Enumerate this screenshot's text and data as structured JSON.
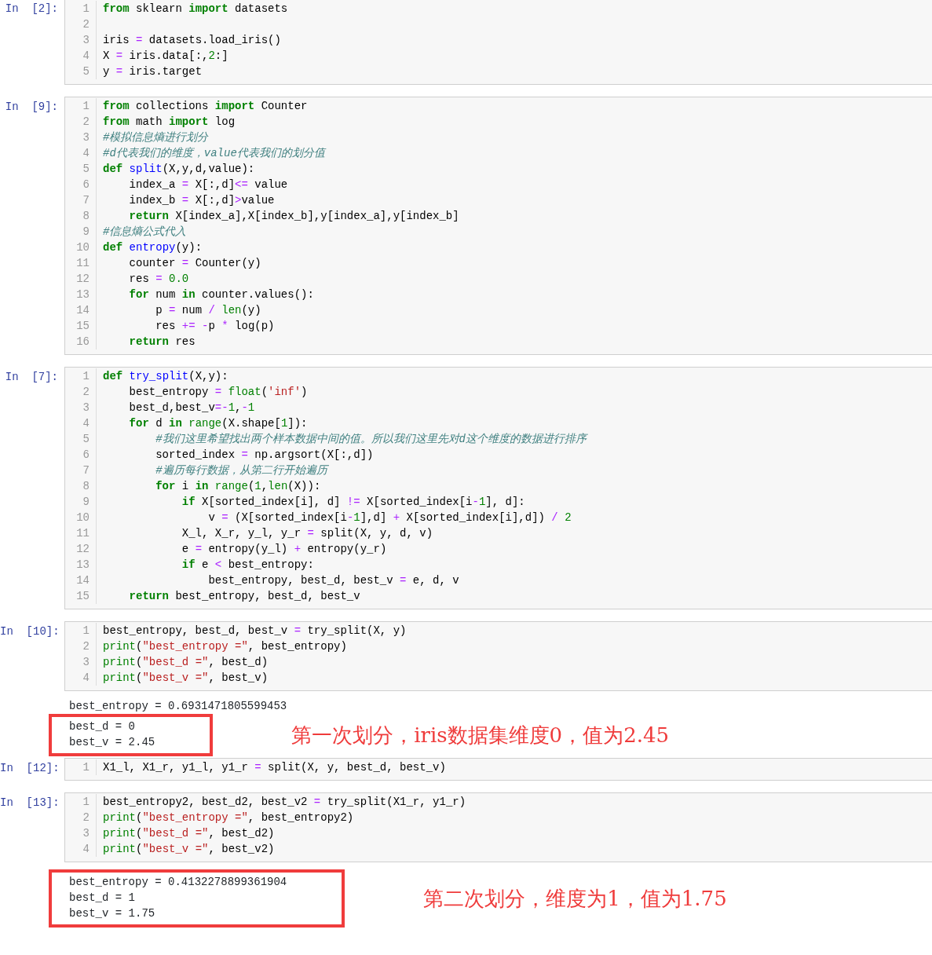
{
  "cells": [
    {
      "prompt": "In  [2]:",
      "lines": [
        {
          "num": "1",
          "tokens": [
            {
              "kind": "kw",
              "text": "from"
            },
            {
              "kind": "tx",
              "text": " sklearn "
            },
            {
              "kind": "kw",
              "text": "import"
            },
            {
              "kind": "tx",
              "text": " datasets"
            }
          ]
        },
        {
          "num": "2"
        },
        {
          "num": "3",
          "tokens": [
            {
              "kind": "tx",
              "text": "iris "
            },
            {
              "kind": "op",
              "text": "="
            },
            {
              "kind": "tx",
              "text": " datasets.load_iris()"
            }
          ]
        },
        {
          "num": "4",
          "tokens": [
            {
              "kind": "tx",
              "text": "X "
            },
            {
              "kind": "op",
              "text": "="
            },
            {
              "kind": "tx",
              "text": " iris.data[:,"
            },
            {
              "kind": "num",
              "text": "2"
            },
            {
              "kind": "tx",
              "text": ":]"
            }
          ]
        },
        {
          "num": "5",
          "tokens": [
            {
              "kind": "tx",
              "text": "y "
            },
            {
              "kind": "op",
              "text": "="
            },
            {
              "kind": "tx",
              "text": " iris.target"
            }
          ]
        }
      ]
    },
    {
      "prompt": "In  [9]:",
      "lines": [
        {
          "num": "1",
          "tokens": [
            {
              "kind": "kw",
              "text": "from"
            },
            {
              "kind": "tx",
              "text": " collections "
            },
            {
              "kind": "kw",
              "text": "import"
            },
            {
              "kind": "tx",
              "text": " Counter"
            }
          ]
        },
        {
          "num": "2",
          "tokens": [
            {
              "kind": "kw",
              "text": "from"
            },
            {
              "kind": "tx",
              "text": " math "
            },
            {
              "kind": "kw",
              "text": "import"
            },
            {
              "kind": "tx",
              "text": " log"
            }
          ]
        },
        {
          "num": "3",
          "tokens": [
            {
              "kind": "cm",
              "text": "#模拟信息熵进行划分"
            }
          ]
        },
        {
          "num": "4",
          "tokens": [
            {
              "kind": "cm",
              "text": "#d代表我们的维度，value代表我们的划分值"
            }
          ]
        },
        {
          "num": "5",
          "tokens": [
            {
              "kind": "kw",
              "text": "def"
            },
            {
              "kind": "fn",
              "text": " split"
            },
            {
              "kind": "tx",
              "text": "(X,y,d,value):"
            }
          ]
        },
        {
          "num": "6",
          "tokens": [
            {
              "kind": "tx",
              "text": "    index_a "
            },
            {
              "kind": "op",
              "text": "="
            },
            {
              "kind": "tx",
              "text": " X[:,d]"
            },
            {
              "kind": "op",
              "text": "<="
            },
            {
              "kind": "tx",
              "text": " value"
            }
          ]
        },
        {
          "num": "7",
          "tokens": [
            {
              "kind": "tx",
              "text": "    index_b "
            },
            {
              "kind": "op",
              "text": "="
            },
            {
              "kind": "tx",
              "text": " X[:,d]"
            },
            {
              "kind": "op",
              "text": ">"
            },
            {
              "kind": "tx",
              "text": "value"
            }
          ]
        },
        {
          "num": "8",
          "tokens": [
            {
              "kind": "kw",
              "text": "    return"
            },
            {
              "kind": "tx",
              "text": " X[index_a],X[index_b],y[index_a],y[index_b]"
            }
          ]
        },
        {
          "num": "9",
          "tokens": [
            {
              "kind": "cm",
              "text": "#信息熵公式代入"
            }
          ]
        },
        {
          "num": "10",
          "tokens": [
            {
              "kind": "kw",
              "text": "def"
            },
            {
              "kind": "fn",
              "text": " entropy"
            },
            {
              "kind": "tx",
              "text": "(y):"
            }
          ]
        },
        {
          "num": "11",
          "tokens": [
            {
              "kind": "tx",
              "text": "    counter "
            },
            {
              "kind": "op",
              "text": "="
            },
            {
              "kind": "tx",
              "text": " Counter(y)"
            }
          ]
        },
        {
          "num": "12",
          "tokens": [
            {
              "kind": "tx",
              "text": "    res "
            },
            {
              "kind": "op",
              "text": "="
            },
            {
              "kind": "num",
              "text": " 0.0"
            }
          ]
        },
        {
          "num": "13",
          "tokens": [
            {
              "kind": "kw",
              "text": "    for"
            },
            {
              "kind": "tx",
              "text": " num "
            },
            {
              "kind": "kw",
              "text": "in"
            },
            {
              "kind": "tx",
              "text": " counter.values():"
            }
          ]
        },
        {
          "num": "14",
          "tokens": [
            {
              "kind": "tx",
              "text": "        p "
            },
            {
              "kind": "op",
              "text": "="
            },
            {
              "kind": "tx",
              "text": " num "
            },
            {
              "kind": "op",
              "text": "/"
            },
            {
              "kind": "bi",
              "text": " len"
            },
            {
              "kind": "tx",
              "text": "(y)"
            }
          ]
        },
        {
          "num": "15",
          "tokens": [
            {
              "kind": "tx",
              "text": "        res "
            },
            {
              "kind": "op",
              "text": "+="
            },
            {
              "kind": "op",
              "text": " -"
            },
            {
              "kind": "tx",
              "text": "p "
            },
            {
              "kind": "op",
              "text": "*"
            },
            {
              "kind": "tx",
              "text": " log(p)"
            }
          ]
        },
        {
          "num": "16",
          "tokens": [
            {
              "kind": "kw",
              "text": "    return"
            },
            {
              "kind": "tx",
              "text": " res"
            }
          ]
        }
      ]
    },
    {
      "prompt": "In  [7]:",
      "lines": [
        {
          "num": "1",
          "tokens": [
            {
              "kind": "kw",
              "text": "def"
            },
            {
              "kind": "fn",
              "text": " try_split"
            },
            {
              "kind": "tx",
              "text": "(X,y):"
            }
          ]
        },
        {
          "num": "2",
          "tokens": [
            {
              "kind": "tx",
              "text": "    best_entropy "
            },
            {
              "kind": "op",
              "text": "="
            },
            {
              "kind": "bi",
              "text": " float"
            },
            {
              "kind": "tx",
              "text": "("
            },
            {
              "kind": "str",
              "text": "'inf'"
            },
            {
              "kind": "tx",
              "text": ")"
            }
          ]
        },
        {
          "num": "3",
          "tokens": [
            {
              "kind": "tx",
              "text": "    best_d,best_v"
            },
            {
              "kind": "op",
              "text": "=-"
            },
            {
              "kind": "num",
              "text": "1"
            },
            {
              "kind": "tx",
              "text": ","
            },
            {
              "kind": "op",
              "text": "-"
            },
            {
              "kind": "num",
              "text": "1"
            }
          ]
        },
        {
          "num": "4",
          "tokens": [
            {
              "kind": "kw",
              "text": "    for"
            },
            {
              "kind": "tx",
              "text": " d "
            },
            {
              "kind": "kw",
              "text": "in"
            },
            {
              "kind": "bi",
              "text": " range"
            },
            {
              "kind": "tx",
              "text": "(X.shape["
            },
            {
              "kind": "num",
              "text": "1"
            },
            {
              "kind": "tx",
              "text": "]):"
            }
          ]
        },
        {
          "num": "5",
          "tokens": [
            {
              "kind": "cm",
              "text": "        #我们这里希望找出两个样本数据中间的值。所以我们这里先对d这个维度的数据进行排序"
            }
          ]
        },
        {
          "num": "6",
          "tokens": [
            {
              "kind": "tx",
              "text": "        sorted_index "
            },
            {
              "kind": "op",
              "text": "="
            },
            {
              "kind": "tx",
              "text": " np.argsort(X[:,d])"
            }
          ]
        },
        {
          "num": "7",
          "tokens": [
            {
              "kind": "cm",
              "text": "        #遍历每行数据，从第二行开始遍历"
            }
          ]
        },
        {
          "num": "8",
          "tokens": [
            {
              "kind": "kw",
              "text": "        for"
            },
            {
              "kind": "tx",
              "text": " i "
            },
            {
              "kind": "kw",
              "text": "in"
            },
            {
              "kind": "bi",
              "text": " range"
            },
            {
              "kind": "tx",
              "text": "("
            },
            {
              "kind": "num",
              "text": "1"
            },
            {
              "kind": "tx",
              "text": ","
            },
            {
              "kind": "bi",
              "text": "len"
            },
            {
              "kind": "tx",
              "text": "(X)):"
            }
          ]
        },
        {
          "num": "9",
          "tokens": [
            {
              "kind": "kw",
              "text": "            if"
            },
            {
              "kind": "tx",
              "text": " X[sorted_index[i], d] "
            },
            {
              "kind": "op",
              "text": "!="
            },
            {
              "kind": "tx",
              "text": " X[sorted_index[i"
            },
            {
              "kind": "op",
              "text": "-"
            },
            {
              "kind": "num",
              "text": "1"
            },
            {
              "kind": "tx",
              "text": "], d]:"
            }
          ]
        },
        {
          "num": "10",
          "tokens": [
            {
              "kind": "tx",
              "text": "                v "
            },
            {
              "kind": "op",
              "text": "="
            },
            {
              "kind": "tx",
              "text": " (X[sorted_index[i"
            },
            {
              "kind": "op",
              "text": "-"
            },
            {
              "kind": "num",
              "text": "1"
            },
            {
              "kind": "tx",
              "text": "],d] "
            },
            {
              "kind": "op",
              "text": "+"
            },
            {
              "kind": "tx",
              "text": " X[sorted_index[i],d]) "
            },
            {
              "kind": "op",
              "text": "/"
            },
            {
              "kind": "num",
              "text": " 2"
            }
          ]
        },
        {
          "num": "11",
          "tokens": [
            {
              "kind": "tx",
              "text": "            X_l, X_r, y_l, y_r "
            },
            {
              "kind": "op",
              "text": "="
            },
            {
              "kind": "tx",
              "text": " split(X, y, d, v)"
            }
          ]
        },
        {
          "num": "12",
          "tokens": [
            {
              "kind": "tx",
              "text": "            e "
            },
            {
              "kind": "op",
              "text": "="
            },
            {
              "kind": "tx",
              "text": " entropy(y_l) "
            },
            {
              "kind": "op",
              "text": "+"
            },
            {
              "kind": "tx",
              "text": " entropy(y_r)"
            }
          ]
        },
        {
          "num": "13",
          "tokens": [
            {
              "kind": "kw",
              "text": "            if"
            },
            {
              "kind": "tx",
              "text": " e "
            },
            {
              "kind": "op",
              "text": "<"
            },
            {
              "kind": "tx",
              "text": " best_entropy:"
            }
          ]
        },
        {
          "num": "14",
          "tokens": [
            {
              "kind": "tx",
              "text": "                best_entropy, best_d, best_v "
            },
            {
              "kind": "op",
              "text": "="
            },
            {
              "kind": "tx",
              "text": " e, d, v"
            }
          ]
        },
        {
          "num": "15",
          "tokens": [
            {
              "kind": "kw",
              "text": "    return"
            },
            {
              "kind": "tx",
              "text": " best_entropy, best_d, best_v"
            }
          ]
        }
      ]
    },
    {
      "prompt": "In  [10]:",
      "lines": [
        {
          "num": "1",
          "tokens": [
            {
              "kind": "tx",
              "text": "best_entropy, best_d, best_v "
            },
            {
              "kind": "op",
              "text": "="
            },
            {
              "kind": "tx",
              "text": " try_split(X, y)"
            }
          ]
        },
        {
          "num": "2",
          "tokens": [
            {
              "kind": "bi",
              "text": "print"
            },
            {
              "kind": "tx",
              "text": "("
            },
            {
              "kind": "str",
              "text": "\"best_entropy =\""
            },
            {
              "kind": "tx",
              "text": ", best_entropy)"
            }
          ]
        },
        {
          "num": "3",
          "tokens": [
            {
              "kind": "bi",
              "text": "print"
            },
            {
              "kind": "tx",
              "text": "("
            },
            {
              "kind": "str",
              "text": "\"best_d =\""
            },
            {
              "kind": "tx",
              "text": ", best_d)"
            }
          ]
        },
        {
          "num": "4",
          "tokens": [
            {
              "kind": "bi",
              "text": "print"
            },
            {
              "kind": "tx",
              "text": "("
            },
            {
              "kind": "str",
              "text": "\"best_v =\""
            },
            {
              "kind": "tx",
              "text": ", best_v)"
            }
          ]
        }
      ],
      "output": {
        "lines": [
          {
            "text": "best_entropy = 0.6931471805599453",
            "boxed": false
          },
          {
            "text": "best_d = 0",
            "boxed": true
          },
          {
            "text": "best_v = 2.45",
            "boxed": true
          }
        ],
        "note": "第一次划分，iris数据集维度0，值为2.45"
      }
    },
    {
      "prompt": "In  [12]:",
      "lines": [
        {
          "num": "1",
          "tokens": [
            {
              "kind": "tx",
              "text": "X1_l, X1_r, y1_l, y1_r "
            },
            {
              "kind": "op",
              "text": "="
            },
            {
              "kind": "tx",
              "text": " split(X, y, best_d, best_v)"
            }
          ]
        }
      ]
    },
    {
      "prompt": "In  [13]:",
      "lines": [
        {
          "num": "1",
          "tokens": [
            {
              "kind": "tx",
              "text": "best_entropy2, best_d2, best_v2 "
            },
            {
              "kind": "op",
              "text": "="
            },
            {
              "kind": "tx",
              "text": " try_split(X1_r, y1_r)"
            }
          ]
        },
        {
          "num": "2",
          "tokens": [
            {
              "kind": "bi",
              "text": "print"
            },
            {
              "kind": "tx",
              "text": "("
            },
            {
              "kind": "str",
              "text": "\"best_entropy =\""
            },
            {
              "kind": "tx",
              "text": ", best_entropy2)"
            }
          ]
        },
        {
          "num": "3",
          "tokens": [
            {
              "kind": "bi",
              "text": "print"
            },
            {
              "kind": "tx",
              "text": "("
            },
            {
              "kind": "str",
              "text": "\"best_d =\""
            },
            {
              "kind": "tx",
              "text": ", best_d2)"
            }
          ]
        },
        {
          "num": "4",
          "tokens": [
            {
              "kind": "bi",
              "text": "print"
            },
            {
              "kind": "tx",
              "text": "("
            },
            {
              "kind": "str",
              "text": "\"best_v =\""
            },
            {
              "kind": "tx",
              "text": ", best_v2)"
            }
          ]
        }
      ],
      "output": {
        "lines": [
          {
            "text": "best_entropy = 0.4132278899361904",
            "boxed": true
          },
          {
            "text": "best_d = 1",
            "boxed": true
          },
          {
            "text": "best_v = 1.75",
            "boxed": true
          }
        ],
        "note": "第二次划分，维度为1，值为1.75"
      }
    }
  ]
}
